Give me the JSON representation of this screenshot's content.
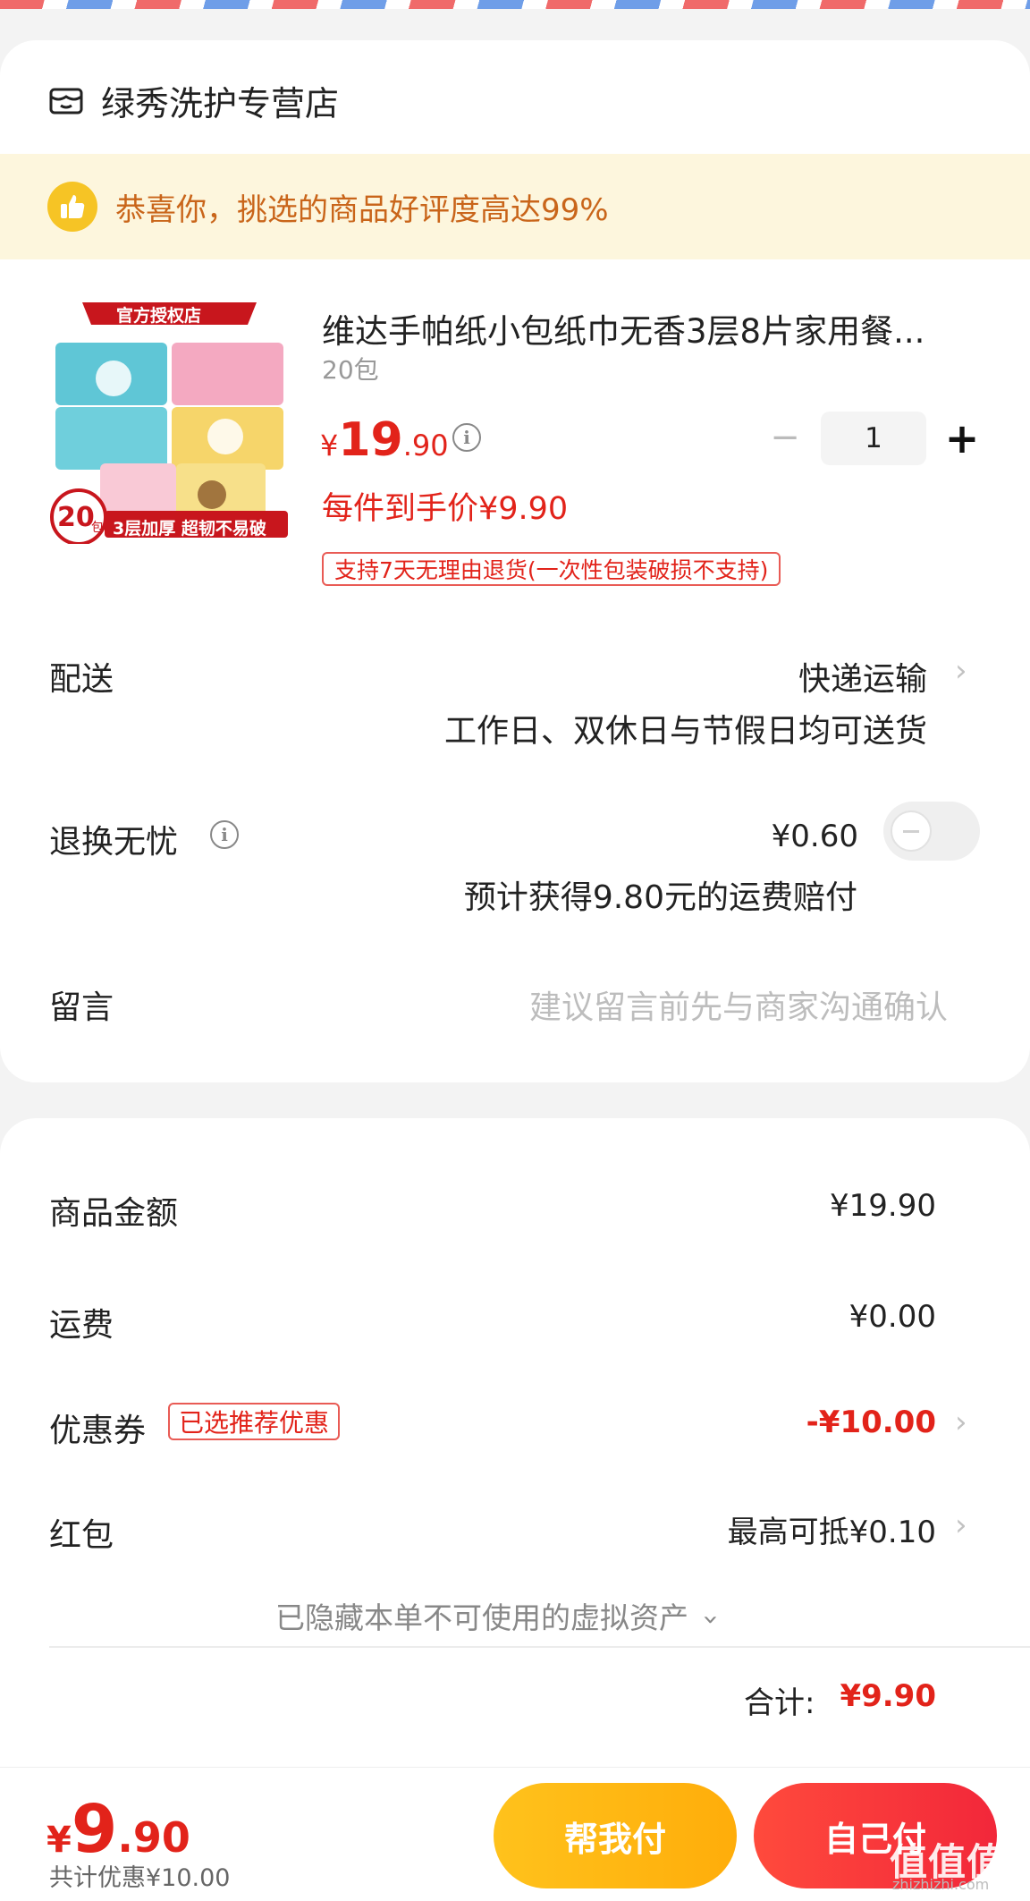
{
  "shop": {
    "name": "绿秀洗护专营店"
  },
  "banner": {
    "text": "恭喜你，挑选的商品好评度高达99%"
  },
  "product": {
    "badge": "官方授权店",
    "image_count_label": "20",
    "image_count_unit": "包",
    "image_tagline": "3层加厚 超韧不易破",
    "title": "维达手帕纸小包纸巾无香3层8片家用餐...",
    "spec": "20包",
    "price_symbol": "¥",
    "price_int": "19",
    "price_dec": ".90",
    "deal_price": "每件到手价¥9.90",
    "return_policy": "支持7天无理由退货(一次性包装破损不支持)",
    "quantity": "1",
    "minus": "−",
    "plus": "+"
  },
  "delivery": {
    "label": "配送",
    "value": "快递运输",
    "note": "工作日、双休日与节假日均可送货"
  },
  "return_worry": {
    "label": "退换无忧",
    "price": "¥0.60",
    "note": "预计获得9.80元的运费赔付",
    "enabled": false
  },
  "message": {
    "label": "留言",
    "placeholder": "建议留言前先与商家沟通确认"
  },
  "summary": {
    "goods_label": "商品金额",
    "goods_value": "¥19.90",
    "shipping_label": "运费",
    "shipping_value": "¥0.00",
    "coupon_label": "优惠券",
    "coupon_badge": "已选推荐优惠",
    "coupon_value": "-¥10.00",
    "redpacket_label": "红包",
    "redpacket_value": "最高可抵¥0.10",
    "hidden_assets": "已隐藏本单不可使用的虚拟资产",
    "total_label": "合计:",
    "total_value": "¥9.90"
  },
  "footer": {
    "price_symbol": "¥",
    "price_int": "9",
    "price_dec": ".90",
    "saved": "共计优惠¥10.00",
    "help_pay": "帮我付",
    "self_pay": "自己付"
  },
  "watermark": {
    "text": "值值值",
    "sub": "zhizhizhi.com"
  },
  "colors": {
    "accent_red": "#e2231a",
    "help_button": "#ffb514",
    "self_button": "#f3303a",
    "banner_bg": "#fdf6dd",
    "banner_text": "#c9651a"
  }
}
